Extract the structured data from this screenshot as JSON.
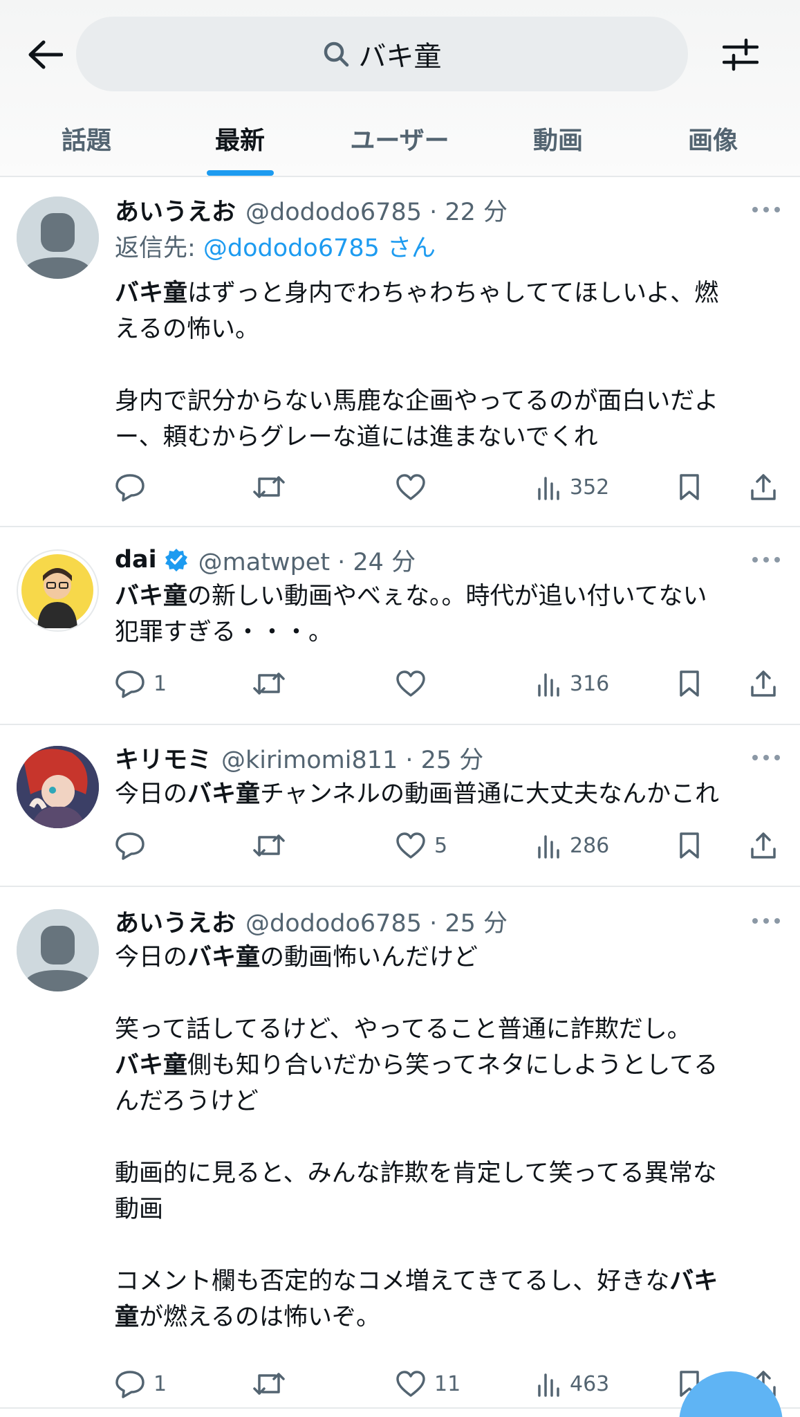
{
  "search": {
    "query": "バキ童"
  },
  "icons": {
    "back": "arrow-left-icon",
    "search": "search-icon",
    "filter": "filter-sliders-icon",
    "reply": "reply-bubble-icon",
    "retweet": "retweet-icon",
    "like": "heart-icon",
    "views": "bar-chart-icon",
    "bookmark": "bookmark-icon",
    "share": "share-icon",
    "verified": "verified-badge-icon",
    "more": "more-dots-icon"
  },
  "colors": {
    "accent": "#1d9bf0",
    "text": "#0f1419",
    "muted": "#536471"
  },
  "tabs": [
    {
      "label": "話題",
      "active": false
    },
    {
      "label": "最新",
      "active": true
    },
    {
      "label": "ユーザー",
      "active": false
    },
    {
      "label": "動画",
      "active": false
    },
    {
      "label": "画像",
      "active": false
    }
  ],
  "tweets": [
    {
      "name": "あいうえお",
      "handle": "@dododo6785 · 22 分",
      "verified": false,
      "reply_prefix": "返信先: ",
      "reply_handle": "@dododo6785 さん",
      "lines": [
        [
          {
            "t": "バキ童",
            "b": true
          },
          {
            "t": "はずっと身内でわちゃわちゃしててほしいよ、燃"
          }
        ],
        [
          {
            "t": "えるの怖い。"
          }
        ],
        [],
        [
          {
            "t": "身内で訳分からない馬鹿な企画やってるのが面白いだよ"
          }
        ],
        [
          {
            "t": "ー、頼むからグレーな道には進まないでくれ"
          }
        ]
      ],
      "replies": "",
      "likes": "",
      "views": "352"
    },
    {
      "name": "dai",
      "handle": "@matwpet · 24 分",
      "verified": true,
      "lines": [
        [
          {
            "t": "バキ童",
            "b": true
          },
          {
            "t": "の新しい動画やべぇな。。時代が追い付いてない"
          }
        ],
        [
          {
            "t": "犯罪すぎる・・・。"
          }
        ]
      ],
      "replies": "1",
      "likes": "",
      "views": "316"
    },
    {
      "name": "キリモミ",
      "handle": "@kirimomi811 · 25 分",
      "verified": false,
      "lines": [
        [
          {
            "t": "今日の"
          },
          {
            "t": "バキ童",
            "b": true
          },
          {
            "t": "チャンネルの動画普通に大丈夫なんかこれ"
          }
        ]
      ],
      "replies": "",
      "likes": "5",
      "views": "286"
    },
    {
      "name": "あいうえお",
      "handle": "@dododo6785 · 25 分",
      "verified": false,
      "lines": [
        [
          {
            "t": "今日の"
          },
          {
            "t": "バキ童",
            "b": true
          },
          {
            "t": "の動画怖いんだけど"
          }
        ],
        [],
        [
          {
            "t": "笑って話してるけど、やってること普通に詐欺だし。"
          }
        ],
        [
          {
            "t": "バキ童",
            "b": true
          },
          {
            "t": "側も知り合いだから笑ってネタにしようとしてる"
          }
        ],
        [
          {
            "t": "んだろうけど"
          }
        ],
        [],
        [
          {
            "t": "動画的に見ると、みんな詐欺を肯定して笑ってる異常な"
          }
        ],
        [
          {
            "t": "動画"
          }
        ],
        [],
        [
          {
            "t": "コメント欄も否定的なコメ増えてきてるし、好きな"
          },
          {
            "t": "バキ",
            "b": true
          }
        ],
        [
          {
            "t": "童",
            "b": true
          },
          {
            "t": "が燃えるのは怖いぞ。"
          }
        ]
      ],
      "replies": "1",
      "likes": "11",
      "views": "463"
    }
  ]
}
